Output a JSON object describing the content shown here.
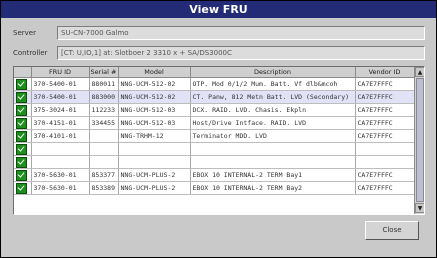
{
  "window": {
    "title": "View FRU"
  },
  "fields": {
    "server_label": "Server",
    "server_value": "SU-CN-7000 Galmo",
    "controller_label": "Controller",
    "controller_value": "[CT: U,IO,1] at: Slotboer 2 3310 x + SA/DS3000C"
  },
  "table": {
    "columns": [
      "FRU ID",
      "Serial #",
      "Model",
      "Description",
      "Vendor ID"
    ],
    "rows": [
      {
        "fru": "370-5400-01",
        "serial": "880011",
        "model": "NNG-UCM-512-02",
        "desc": "OTP. Mod 0/1/2 Mum. Batt. Vf dlb&mcoh",
        "vendor": "CA7E7FFFC"
      },
      {
        "fru": "370-5400-01",
        "serial": "883000",
        "model": "NNG-UCM-512-02",
        "desc": "CT. Panw, 812 Metn Batt. LVD (Secondary)",
        "vendor": "CA7E7FFFC"
      },
      {
        "fru": "375-3024-01",
        "serial": "112233",
        "model": "NNG-UCM-512-03",
        "desc": "DCX. RAID. LVD. Chasis. Ekpln",
        "vendor": "CA7E7FFFC"
      },
      {
        "fru": "370-4151-01",
        "serial": "334455",
        "model": "NNG-UCM-512-03",
        "desc": "Host/Drive Intface. RAID. LVD",
        "vendor": "CA7E7FFFC"
      },
      {
        "fru": "370-4101-01",
        "serial": "",
        "model": "NNG-TRHM-12",
        "desc": "Terminator MDD. LVD",
        "vendor": "CA7E7FFFC"
      },
      {
        "fru": "",
        "serial": "",
        "model": "",
        "desc": "",
        "vendor": ""
      },
      {
        "fru": "",
        "serial": "",
        "model": "",
        "desc": "",
        "vendor": ""
      },
      {
        "fru": "370-5630-01",
        "serial": "853377",
        "model": "NNG-UCM-PLUS-2",
        "desc": "EBOX 10 INTERNAL-2 TERM Bay1",
        "vendor": "CA7E7FFFC"
      },
      {
        "fru": "370-5630-01",
        "serial": "853389",
        "model": "NNG-UCM-PLUS-2",
        "desc": "EBOX 10 INTERNAL-2 TERM Bay2",
        "vendor": "CA7E7FFFC"
      }
    ]
  },
  "buttons": {
    "close": "Close"
  }
}
